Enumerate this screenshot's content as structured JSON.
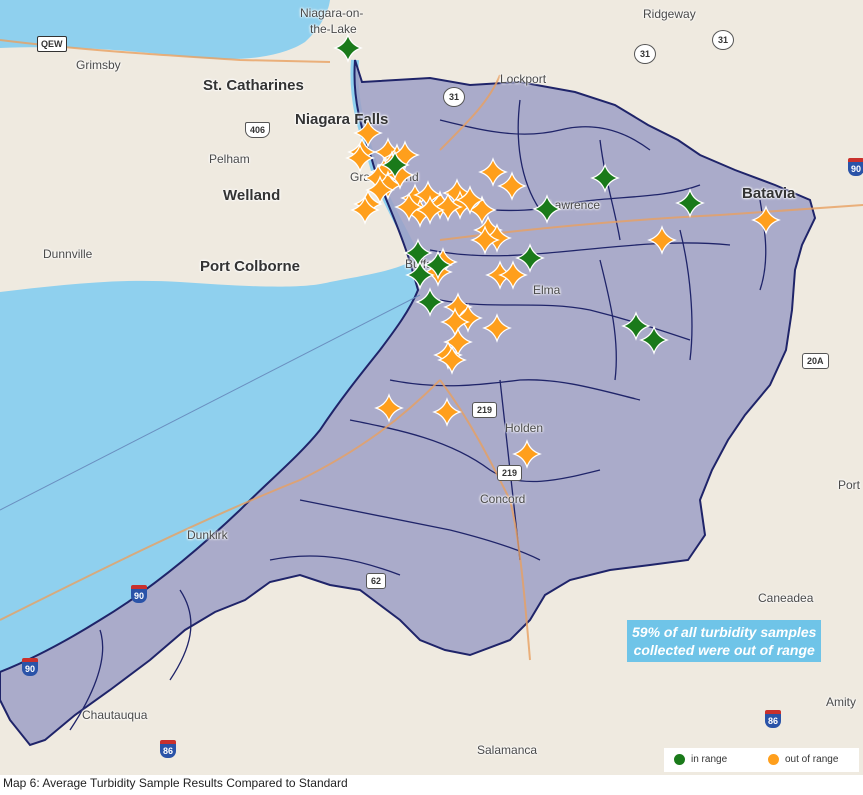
{
  "colors": {
    "water": "#8fd0ee",
    "land": "#efeae0",
    "watershed_fill": "#9ea0c6",
    "watershed_border": "#1f2469",
    "in_range": "#1a7a1a",
    "out_of_range": "#ff9f1c"
  },
  "places": [
    {
      "id": "niagara-on-the-lake-1",
      "label": "Niagara-on-"
    },
    {
      "id": "niagara-on-the-lake-2",
      "label": "the-Lake"
    },
    {
      "id": "ridgeway",
      "label": "Ridgeway"
    },
    {
      "id": "grimsby",
      "label": "Grimsby"
    },
    {
      "id": "st-catharines",
      "label": "St. Catharines",
      "big": true
    },
    {
      "id": "lockport",
      "label": "Lockport"
    },
    {
      "id": "niagara-falls",
      "label": "Niagara Falls",
      "big": true
    },
    {
      "id": "pelham",
      "label": "Pelham"
    },
    {
      "id": "welland",
      "label": "Welland",
      "big": true
    },
    {
      "id": "grand-island",
      "label": "Grand Island"
    },
    {
      "id": "lawrence",
      "label": "Lawrence"
    },
    {
      "id": "batavia",
      "label": "Batavia"
    },
    {
      "id": "dunnville",
      "label": "Dunnville"
    },
    {
      "id": "port-colborne",
      "label": "Port Colborne",
      "big": true
    },
    {
      "id": "buffalo",
      "label": "Buffalo"
    },
    {
      "id": "elma",
      "label": "Elma"
    },
    {
      "id": "holden",
      "label": "Holden"
    },
    {
      "id": "concord",
      "label": "Concord"
    },
    {
      "id": "dunkirk",
      "label": "Dunkirk"
    },
    {
      "id": "caneadea",
      "label": "Caneadea"
    },
    {
      "id": "port",
      "label": "Port"
    },
    {
      "id": "amity",
      "label": "Amity"
    },
    {
      "id": "chautauqua",
      "label": "Chautauqua"
    },
    {
      "id": "salamanca",
      "label": "Salamanca"
    }
  ],
  "shields": [
    {
      "id": "qew",
      "label": "QEW",
      "kind": "qew"
    },
    {
      "id": "hwy-406",
      "label": "406",
      "kind": "on"
    },
    {
      "id": "ny-31-a",
      "label": "31",
      "kind": "ny"
    },
    {
      "id": "ny-31-b",
      "label": "31",
      "kind": "ny"
    },
    {
      "id": "ny-31-c",
      "label": "31",
      "kind": "ny"
    },
    {
      "id": "us-219-a",
      "label": "219",
      "kind": "us"
    },
    {
      "id": "us-219-b",
      "label": "219",
      "kind": "us"
    },
    {
      "id": "us-62",
      "label": "62",
      "kind": "us"
    },
    {
      "id": "us-20a",
      "label": "20A",
      "kind": "us"
    },
    {
      "id": "i-90-a",
      "label": "90",
      "kind": "i"
    },
    {
      "id": "i-90-b",
      "label": "90",
      "kind": "i"
    },
    {
      "id": "i-90-c",
      "label": "90",
      "kind": "i"
    },
    {
      "id": "i-86-a",
      "label": "86",
      "kind": "i"
    },
    {
      "id": "i-86-b",
      "label": "86",
      "kind": "i"
    }
  ],
  "sample_sites": {
    "in_range_count": 16,
    "out_of_range_count": 46
  },
  "callout": {
    "line1": "59% of all turbidity samples",
    "line2": "collected were out of range"
  },
  "legend": {
    "in_range_label": "in range",
    "out_of_range_label": "out of range"
  },
  "caption": "Map 6: Average Turbidity Sample Results Compared to Standard"
}
